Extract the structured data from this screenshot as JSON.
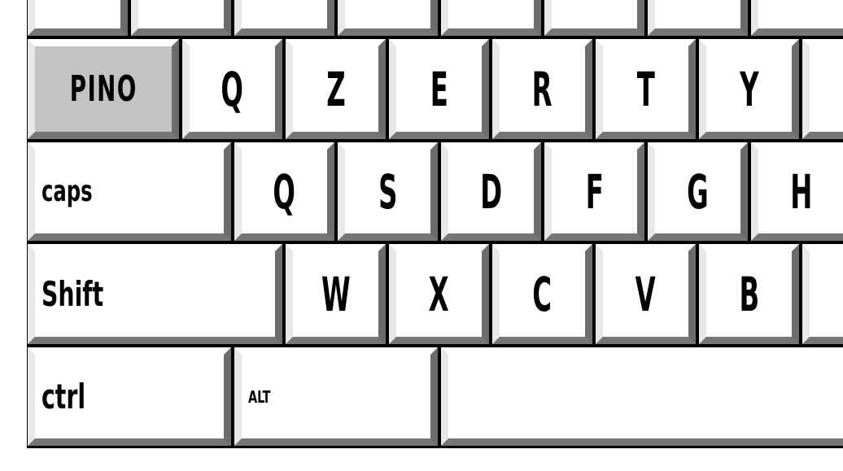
{
  "keyboard": {
    "row0": [
      "",
      "",
      "",
      "",
      "",
      "",
      "",
      ""
    ],
    "row1": {
      "active_key": "PINO",
      "keys": [
        "Q",
        "Z",
        "E",
        "R",
        "T",
        "Y",
        ""
      ]
    },
    "row2": {
      "caps_label": "caps",
      "keys": [
        "Q",
        "S",
        "D",
        "F",
        "G",
        "H"
      ]
    },
    "row3": {
      "shift_label": "Shift",
      "keys": [
        "W",
        "X",
        "C",
        "V",
        "B",
        ""
      ]
    },
    "row4": {
      "ctrl_label": "ctrl",
      "alt_label": "ALT",
      "space_label": ""
    },
    "colors": {
      "key_face": "#ffffff",
      "active_face": "#c3c3c3",
      "bevel_light": "#ffffff",
      "bevel_dark": "#6c6c6c",
      "outline": "#000000"
    }
  }
}
